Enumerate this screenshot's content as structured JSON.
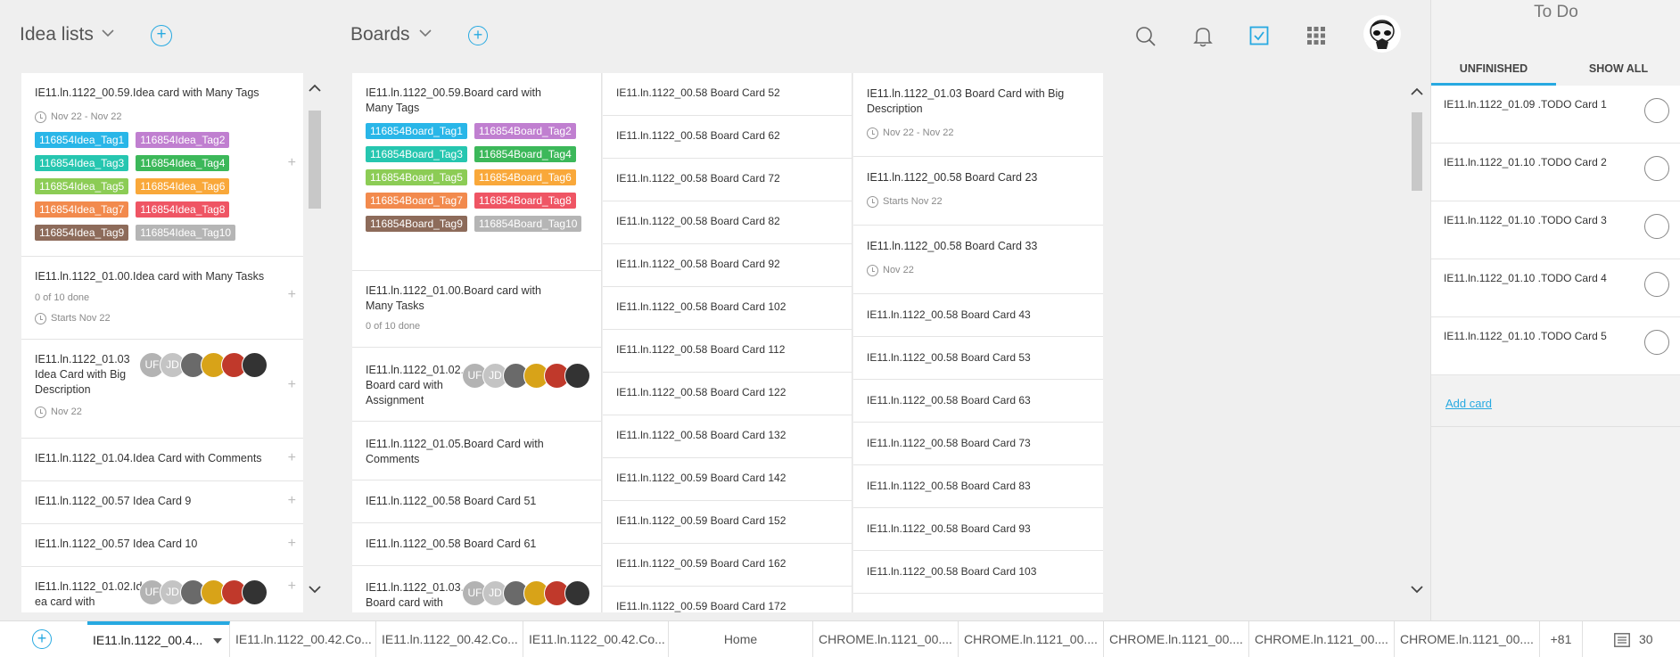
{
  "header": {
    "idea_lists_title": "Idea lists",
    "boards_title": "Boards",
    "todo_title": "To Do"
  },
  "idea_cards": [
    {
      "title": "IE11.ln.1122_00.59.Idea card with Many Tags",
      "date": "Nov 22 - Nov 22"
    },
    {
      "title": "IE11.ln.1122_01.00.Idea card with Many Tasks",
      "tasks": "0 of 10 done",
      "date": "Starts Nov 22"
    },
    {
      "title": "IE11.ln.1122_01.03 Idea Card with Big Description",
      "date": "Nov 22"
    },
    {
      "title": "IE11.ln.1122_01.04.Idea Card with Comments"
    },
    {
      "title": "IE11.ln.1122_00.57 Idea Card 9"
    },
    {
      "title": "IE11.ln.1122_00.57 Idea Card 10"
    },
    {
      "title": "IE11.ln.1122_01.02.Id ea card with"
    }
  ],
  "idea_tags": [
    {
      "label": "116854Idea_Tag1",
      "color": "#29b6e8"
    },
    {
      "label": "116854Idea_Tag2",
      "color": "#c07fd0"
    },
    {
      "label": "116854Idea_Tag3",
      "color": "#26c6b0"
    },
    {
      "label": "116854Idea_Tag4",
      "color": "#3cb85a"
    },
    {
      "label": "116854Idea_Tag5",
      "color": "#8ccc55"
    },
    {
      "label": "116854Idea_Tag6",
      "color": "#f9a83a"
    },
    {
      "label": "116854Idea_Tag7",
      "color": "#f28a4d"
    },
    {
      "label": "116854Idea_Tag8",
      "color": "#ef5564"
    },
    {
      "label": "116854Idea_Tag9",
      "color": "#8d6b5a"
    },
    {
      "label": "116854Idea_Tag10",
      "color": "#b5b5b5"
    }
  ],
  "board_col1": [
    {
      "title": "IE11.ln.1122_00.59.Board card with Many Tags"
    },
    {
      "title": "IE11.ln.1122_01.00.Board card with Many Tasks",
      "tasks": "0 of 10 done"
    },
    {
      "title": "IE11.ln.1122_01.02. Board card with Assignment"
    },
    {
      "title": "IE11.ln.1122_01.05.Board Card with Comments"
    },
    {
      "title": "IE11.ln.1122_00.58 Board Card 51"
    },
    {
      "title": "IE11.ln.1122_00.58 Board Card 61"
    },
    {
      "title": "IE11.ln.1122_01.03. Board card with"
    }
  ],
  "board_tags": [
    {
      "label": "116854Board_Tag1",
      "color": "#29b6e8"
    },
    {
      "label": "116854Board_Tag2",
      "color": "#c07fd0"
    },
    {
      "label": "116854Board_Tag3",
      "color": "#26c6b0"
    },
    {
      "label": "116854Board_Tag4",
      "color": "#3cb85a"
    },
    {
      "label": "116854Board_Tag5",
      "color": "#8ccc55"
    },
    {
      "label": "116854Board_Tag6",
      "color": "#f9a83a"
    },
    {
      "label": "116854Board_Tag7",
      "color": "#f28a4d"
    },
    {
      "label": "116854Board_Tag8",
      "color": "#ef5564"
    },
    {
      "label": "116854Board_Tag9",
      "color": "#8d6b5a"
    },
    {
      "label": "116854Board_Tag10",
      "color": "#b5b5b5"
    }
  ],
  "avatars": [
    {
      "label": "UF",
      "color": "#b3b3b3"
    },
    {
      "label": "JD",
      "color": "#c4c4c4"
    },
    {
      "label": "",
      "color": "#6a6a6a"
    },
    {
      "label": "",
      "color": "#d8a318"
    },
    {
      "label": "",
      "color": "#c0392b"
    },
    {
      "label": "",
      "color": "#333333"
    }
  ],
  "board_col2": [
    "IE11.ln.1122_00.58 Board Card 52",
    "IE11.ln.1122_00.58 Board Card 62",
    "IE11.ln.1122_00.58 Board Card 72",
    "IE11.ln.1122_00.58 Board Card 82",
    "IE11.ln.1122_00.58 Board Card 92",
    "IE11.ln.1122_00.58 Board Card 102",
    "IE11.ln.1122_00.58 Board Card 112",
    "IE11.ln.1122_00.58 Board Card 122",
    "IE11.ln.1122_00.58 Board Card 132",
    "IE11.ln.1122_00.59 Board Card 142",
    "IE11.ln.1122_00.59 Board Card 152",
    "IE11.ln.1122_00.59 Board Card 162",
    "IE11.ln.1122_00.59 Board Card 172"
  ],
  "board_col3": [
    {
      "title": "IE11.ln.1122_01.03 Board Card with Big Description",
      "date": "Nov 22 - Nov 22"
    },
    {
      "title": "IE11.ln.1122_00.58 Board Card 23",
      "date": "Starts Nov 22"
    },
    {
      "title": "IE11.ln.1122_00.58 Board Card 33",
      "date": "Nov 22"
    },
    {
      "title": "IE11.ln.1122_00.58 Board Card 43"
    },
    {
      "title": "IE11.ln.1122_00.58 Board Card 53"
    },
    {
      "title": "IE11.ln.1122_00.58 Board Card 63"
    },
    {
      "title": "IE11.ln.1122_00.58 Board Card 73"
    },
    {
      "title": "IE11.ln.1122_00.58 Board Card 83"
    },
    {
      "title": "IE11.ln.1122_00.58 Board Card 93"
    },
    {
      "title": "IE11.ln.1122_00.58 Board Card 103"
    }
  ],
  "todo": {
    "tabs": [
      "UNFINISHED",
      "SHOW ALL"
    ],
    "cards": [
      "IE11.ln.1122_01.09 .TODO Card 1",
      "IE11.ln.1122_01.10 .TODO Card 2",
      "IE11.ln.1122_01.10 .TODO Card 3",
      "IE11.ln.1122_01.10 .TODO Card 4",
      "IE11.ln.1122_01.10 .TODO Card 5"
    ],
    "add_card_label": "Add card"
  },
  "tabbar": {
    "tabs": [
      "IE11.ln.1122_00.4...",
      "IE11.ln.1122_00.42.Co...",
      "IE11.ln.1122_00.42.Co...",
      "IE11.ln.1122_00.42.Co...",
      "Home",
      "CHROME.ln.1121_00....",
      "CHROME.ln.1121_00....",
      "CHROME.ln.1121_00....",
      "CHROME.ln.1121_00....",
      "CHROME.ln.1121_00...."
    ],
    "more_label": "+81",
    "count_label": "30"
  },
  "colors": {
    "accent": "#27a9e1",
    "background": "#efefef"
  }
}
